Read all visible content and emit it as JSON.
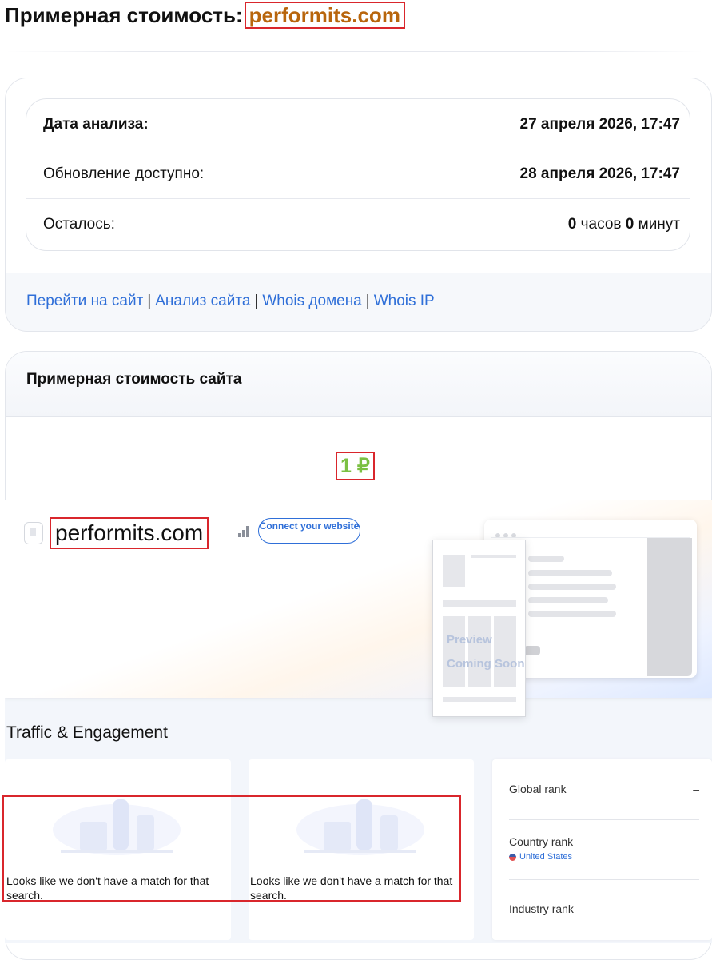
{
  "header": {
    "title_prefix": "Примерная стоимость:",
    "domain": "performits.com"
  },
  "info": {
    "rows": [
      {
        "label": "Дата анализа:",
        "value": "27 апреля 2026, 17:47"
      },
      {
        "label": "Обновление доступно:",
        "value": "28 апреля 2026, 17:47"
      },
      {
        "label": "Осталось:",
        "hours": "0",
        "hours_unit": "часов",
        "minutes": "0",
        "minutes_unit": "минут"
      }
    ],
    "links": [
      "Перейти на сайт",
      "Анализ сайта",
      "Whois домена",
      "Whois IP"
    ],
    "separator": "|"
  },
  "cost": {
    "title": "Примерная стоимость сайта",
    "price": "1 ₽",
    "price_color": "#7bc043"
  },
  "widget": {
    "site_name": "performits.com",
    "connect_label": "Connect your website",
    "preview_line1": "Preview",
    "preview_line2": "Coming Soon",
    "section_title": "Traffic & Engagement",
    "empty_message": "Looks like we don't have a match for that search.",
    "ranks": [
      {
        "label": "Global rank",
        "value": "–"
      },
      {
        "label": "Country rank",
        "value": "–",
        "sub": "United States"
      },
      {
        "label": "Industry rank",
        "value": "–"
      }
    ]
  },
  "colors": {
    "link": "#2f6fd8",
    "domain_title": "#b8650c",
    "highlight_box": "#d9262c"
  }
}
